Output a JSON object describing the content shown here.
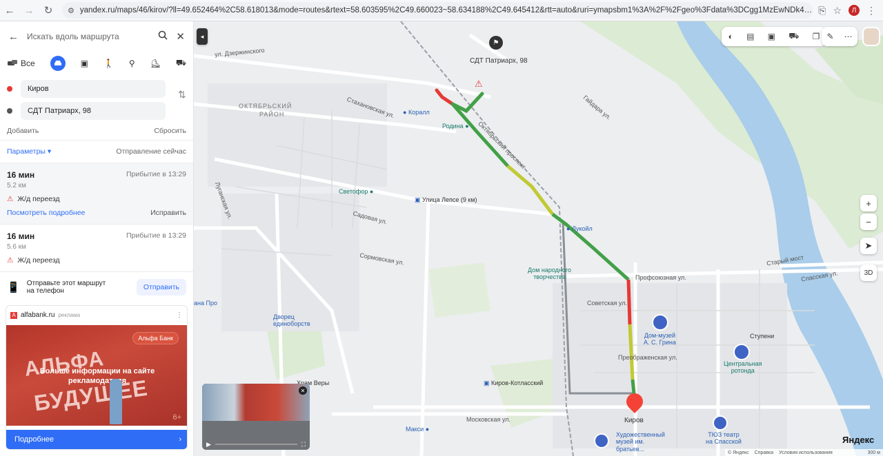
{
  "browser": {
    "url": "yandex.ru/maps/46/kirov/?ll=49.652464%2C58.618013&mode=routes&rtext=58.603595%2C49.660023~58.634188%2C49.645412&rtt=auto&ruri=ymapsbm1%3A%2F%2Fgeo%3Fdata%3DCgg1MzEwNDk4MBIY0KDQvtGB0YHQuNGPLCDQmtC40YDQvtCylgo..."
  },
  "sidebar": {
    "search_placeholder": "Искать вдоль маршрута",
    "mode_all": "Все",
    "from": "Киров",
    "to": "СДТ Патриарх, 98",
    "add": "Добавить",
    "reset": "Сбросить",
    "params": "Параметры ▾",
    "departure": "Отправление сейчас",
    "routes": [
      {
        "time": "16 мин",
        "arrival": "Прибытие в 13:29",
        "distance": "5.2 км",
        "warning": "Ж/д переезд",
        "details": "Посмотреть подробнее",
        "fix": "Исправить"
      },
      {
        "time": "16 мин",
        "arrival": "Прибытие в 13:29",
        "distance": "5.6 км",
        "warning": "Ж/д переезд"
      }
    ],
    "send_text_1": "Отправьте этот маршрут",
    "send_text_2": "на телефон",
    "send_button": "Отправить",
    "ad": {
      "source": "alfabank.ru",
      "tag": "реклама",
      "brand": "Альфа Банк",
      "overlay_1": "Больше информации на сайте",
      "overlay_2": "рекламодателя",
      "big_1": "АЛЬФА",
      "big_2": "БУДУЩЕЕ",
      "age": "6+",
      "cta": "Подробнее"
    }
  },
  "map": {
    "destination": "СДТ Патриарх, 98",
    "districts": [
      "ОКТЯБРЬСКИЙ",
      "РАЙОН"
    ],
    "streets": [
      "ул. Дзержинского",
      "Октябрьский проспект",
      "Профсоюзная ул.",
      "Московская ул.",
      "Преображенская ул.",
      "Советская ул.",
      "Сормовская ул.",
      "Луганская ул.",
      "Стахановская ул.",
      "Садовая ул.",
      "Старый мост",
      "Спасская ул.",
      "Гайдара ул."
    ],
    "pois": {
      "korall": "Коралл",
      "rodina": "Родина",
      "svetofor": "Светофор",
      "lepse": "Улица Лепсе (9 км)",
      "lukoil": "Лукойл",
      "dom_tv": [
        "Дом народного",
        "творчества"
      ],
      "dvorets": [
        "Дворец",
        "единоборств"
      ],
      "grin": [
        "Дом-музей",
        "А. С. Грина"
      ],
      "rotonda": [
        "Центральная",
        "ротонда"
      ],
      "stupeni": "Ступени",
      "vasnetsov": [
        "Художественный",
        "музей им.",
        "братьев..."
      ],
      "tyuz": [
        "ТЮЗ театр",
        "на Спасской"
      ],
      "kirov_kotl": "Киров-Котласский",
      "maksi": "Макси",
      "khram": "Храм Веры",
      "kirov": "Киров",
      "ana": "ана Про"
    },
    "controls": {
      "zoom_in": "+",
      "zoom_out": "−",
      "three_d": "3D",
      "scale": "300 м"
    },
    "footer": [
      "© Яндекс",
      "Справка",
      "Условия использования"
    ],
    "logo": "Яндекс"
  }
}
